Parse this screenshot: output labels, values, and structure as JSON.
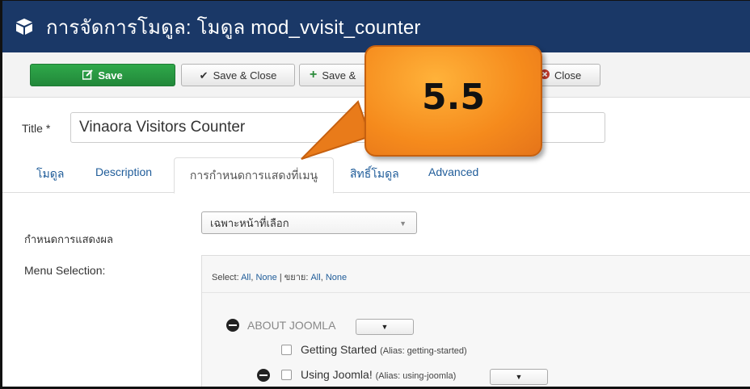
{
  "header": {
    "title": "การจัดการโมดูล: โมดูล mod_vvisit_counter",
    "icon": "cube-icon",
    "bg_color": "#1a3867"
  },
  "toolbar": {
    "save_label": "Save",
    "save_close_label": "Save & Close",
    "save_new_label": "Save &",
    "close_label": "Close",
    "accent_green": "#2fa84a"
  },
  "form": {
    "title_label": "Title *",
    "title_value": "Vinaora Visitors Counter"
  },
  "tabs": [
    {
      "label": "โมดูล"
    },
    {
      "label": "Description"
    },
    {
      "label": "การกำหนดการแสดงที่เมนู"
    },
    {
      "label": "สิทธิ์โมดูล"
    },
    {
      "label": "Advanced"
    }
  ],
  "assignment": {
    "label": "กำหนดการแสดงผล",
    "selected": "เฉพาะหน้าที่เลือก"
  },
  "menu_selection": {
    "label": "Menu Selection:",
    "select_prefix": "Select:",
    "all": "All",
    "none": "None",
    "sep": "|",
    "expand_prefix": "ขยาย:",
    "menu_title": "ABOUT JOOMLA",
    "items": [
      {
        "title": "Getting Started",
        "alias": "(Alias: getting-started)"
      },
      {
        "title": "Using Joomla!",
        "alias": "(Alias: using-joomla)"
      }
    ]
  },
  "callout": {
    "text": "5.5",
    "color": "#f58a1c"
  }
}
